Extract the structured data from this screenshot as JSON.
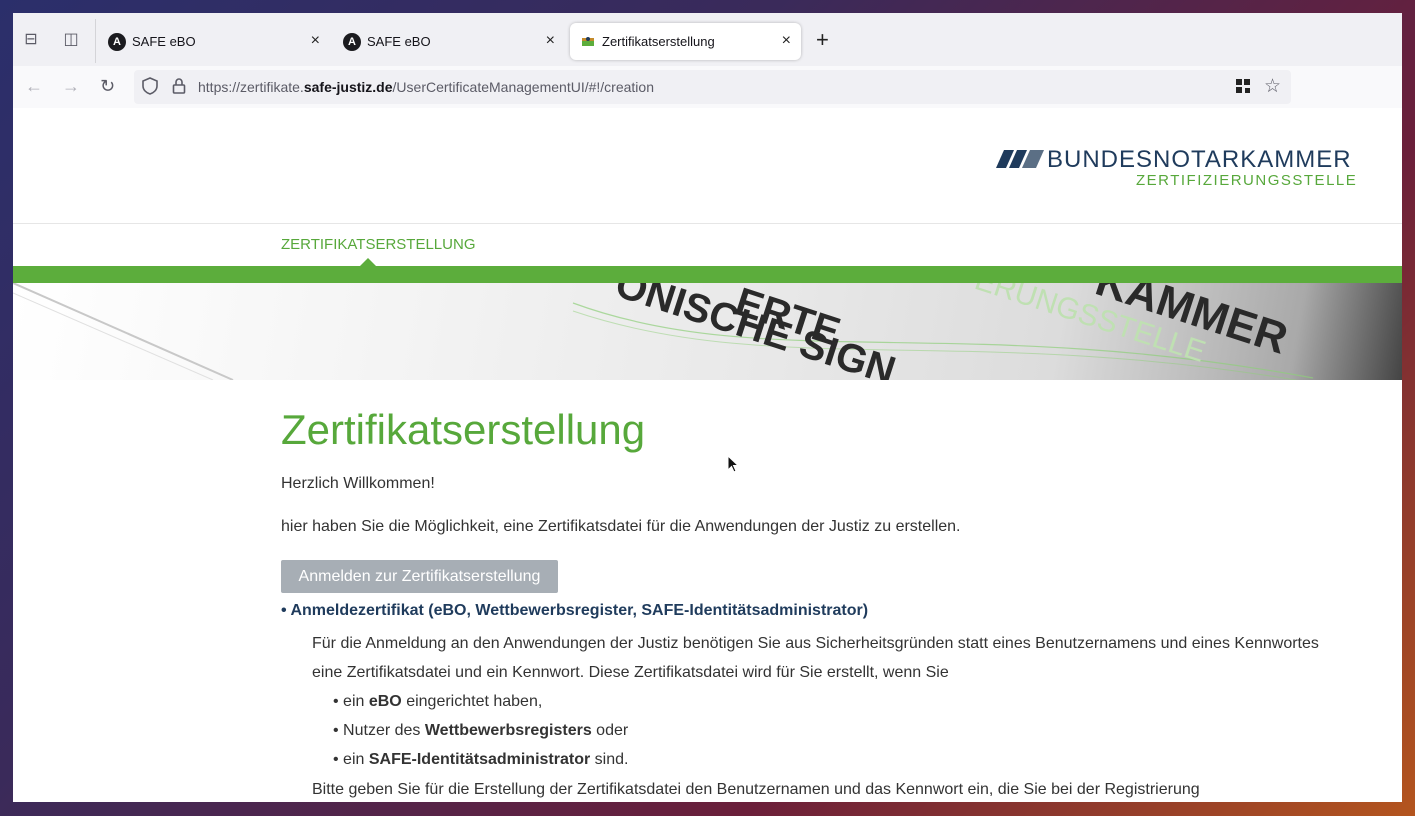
{
  "browser": {
    "tabs": [
      {
        "label": "SAFE eBO",
        "favicon": "A",
        "close": "×"
      },
      {
        "label": "SAFE eBO",
        "favicon": "A",
        "close": "×"
      },
      {
        "label": "Zertifikatserstellung",
        "favicon": "",
        "close": "×"
      }
    ],
    "new_tab": "+",
    "url": {
      "prefix": "https://zertifikate.",
      "domain": "safe-justiz.de",
      "path": "/UserCertificateManagementUI/#!/creation"
    }
  },
  "header": {
    "logo_name": "BUNDESNOTARKAMMER",
    "logo_sub": "ZERTIFIZIERUNGSSTELLE",
    "nav_item": "ZERTIFIKATSERSTELLUNG",
    "accent_color": "#5cad3c"
  },
  "banner": {
    "line1": "ERTE",
    "line2": "ONISCHE SIGN",
    "line3": "KAMMER",
    "line4": "ERUNGSSTELLE"
  },
  "main": {
    "title": "Zertifikatserstellung",
    "welcome": "Herzlich Willkommen!",
    "intro": "hier haben Sie die Möglichkeit, eine Zertifikatsdatei für die Anwendungen der Justiz zu erstellen.",
    "login_button": "Anmelden zur Zertifikatserstellung",
    "section_title": "• Anmeldezertifikat (eBO, Wettbewerbsregister, SAFE-Identitätsadministrator)",
    "para1": "Für die Anmeldung an den Anwendungen der Justiz benötigen Sie aus Sicherheitsgründen statt eines Benutzernamens und eines Kennwortes",
    "para2": "eine Zertifikatsdatei und ein Kennwort. Diese Zertifikatsdatei wird für Sie erstellt, wenn Sie",
    "bullets": [
      {
        "pre": "• ein ",
        "bold": "eBO",
        "post": " eingerichtet haben,"
      },
      {
        "pre": "• Nutzer des ",
        "bold": "Wettbewerbsregisters",
        "post": " oder"
      },
      {
        "pre": "• ein ",
        "bold": "SAFE-Identitätsadministrator",
        "post": " sind."
      }
    ],
    "para3": "Bitte geben Sie für die Erstellung der Zertifikatsdatei den Benutzernamen und das Kennwort ein, die Sie bei der Registrierung"
  }
}
